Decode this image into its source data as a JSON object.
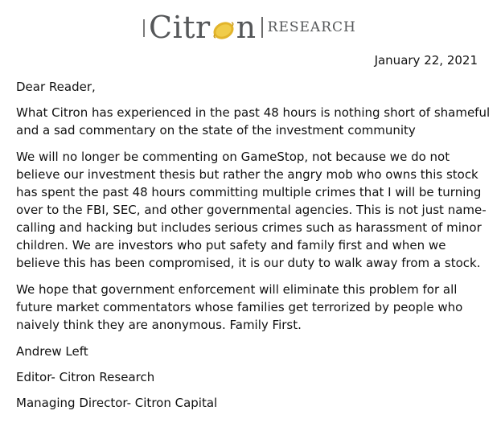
{
  "logo": {
    "brand_prefix": "Citr",
    "brand_suffix": "n",
    "subtitle": "RESEARCH",
    "lemon_color": "#e2b42b"
  },
  "letter": {
    "date": "January 22, 2021",
    "salutation": "Dear Reader,",
    "paragraphs": [
      "What Citron has experienced in the past 48 hours is nothing short of shameful and a sad commentary on the state of the investment community",
      "We will no longer be commenting on GameStop, not because we do not believe our investment thesis but rather the angry mob who owns this stock has spent the past 48 hours committing multiple crimes that I will be turning over to the FBI, SEC, and other governmental agencies.  This is not just name-calling and hacking but includes serious crimes such as harassment of minor children.  We are investors who put safety and family first and when we believe this has been compromised, it is our duty to walk away from a stock.",
      "We hope that government enforcement will eliminate this problem for all future market commentators whose families get terrorized by people who naively think they are anonymous.   Family First."
    ],
    "signature": {
      "name": "Andrew Left",
      "title_1": "Editor- Citron Research",
      "title_2": "Managing Director- Citron Capital"
    }
  }
}
